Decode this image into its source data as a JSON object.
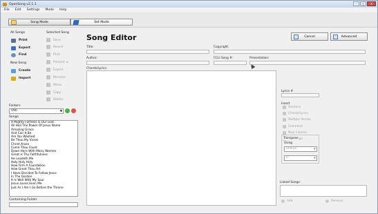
{
  "window": {
    "title": "OpenSong v2.1.1",
    "buttons": [
      "–",
      "□",
      "X"
    ]
  },
  "menu": [
    "File",
    "Edit",
    "Settings",
    "Mode",
    "Help"
  ],
  "modes": {
    "song_mode": "Song Mode",
    "set_mode": "Set Mode"
  },
  "left": {
    "all_songs_header": "All Songs",
    "selected_song_header": "Selected Song",
    "all_songs_buttons": [
      "Print",
      "Export",
      "Find"
    ],
    "new_song_header": "New Song",
    "new_song_buttons": [
      "Create",
      "Import"
    ],
    "selected_song_buttons": [
      "Save",
      "Revert",
      "Print",
      "Present",
      "Export",
      "Rename",
      "Move",
      "Copy",
      "Delete"
    ],
    "folders_label": "Folders",
    "folder_value": "(All)",
    "songs_label": "Songs",
    "songs": [
      "A Mighty Fortress Is Our God",
      "All Hail The Power Of Jesus Name",
      "Amazing Grace",
      "And Can It Be",
      "Are You Washed",
      "Be Thou My Vision",
      "Christ Arose",
      "Come Thou Fount",
      "Down Here With Many Women",
      "Great is Thy Faithfulness",
      "He Leadeth Me",
      "Holy Holy Holy",
      "How Firm A Foundation",
      "How Great Thou Art",
      "I Have Decided To Follow Jesus",
      "In The Garden",
      "It Is Well With My Soul",
      "Jesus Loves Even Me",
      "Just As I Am I Go Before the Throne"
    ],
    "containing_folder_label": "Containing Folder"
  },
  "editor": {
    "title": "Song Editor",
    "cancel_label": "Cancel",
    "advanced_label": "Advanced",
    "title_label": "Title:",
    "copyright_label": "Copyright:",
    "author_label": "Author:",
    "ccli_label": "CCLI Song #:",
    "presentation_label": "Presentation:",
    "chords_label": "Chords/Lyrics:",
    "lyrics_font_label": "Lyrics #",
    "insert_label": "Insert",
    "insert_items": [
      "Sections",
      "Chords/Lyrics",
      "Multiple Verses",
      "Comment",
      "New Column",
      "New Page"
    ],
    "transpose_label": "Transpose",
    "transpose_sub": "Using",
    "transpose_select_1": "Sharps",
    "transpose_select_2": "0",
    "linked_songs_label": "Linked Songs:",
    "add_label": "Add",
    "remove_label": "Remove"
  },
  "colors": {
    "accent": "#2f69c6",
    "disabled_text": "#a0a0a0"
  }
}
